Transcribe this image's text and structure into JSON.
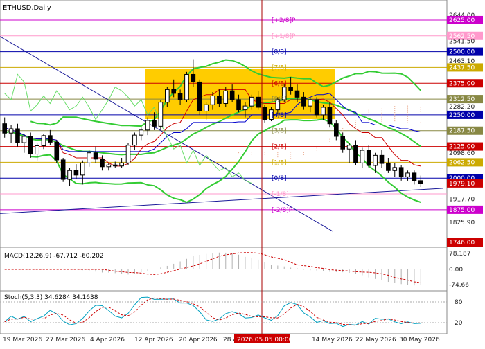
{
  "symbol_label": "ETHUSD,Daily",
  "macd_label": "MACD(12,26,9) -67.712 -60.202",
  "stoch_label": "Stoch(5,3,3) 34.6284 34.1638",
  "crosshair_label": "2026.05.05 00:00",
  "colors": {
    "background": "#ffffff",
    "bull": "#ffffff",
    "bear": "#000000",
    "bollinger": "#33cc33",
    "tenkan": "#cc0000",
    "kijun": "#0000cc",
    "chikou": "#66dd66",
    "highlight_box": "#ffcc00",
    "crosshair": "#aa0000",
    "trendline": "#1a1a99",
    "axis_text": "#222222",
    "price_highlight": "#cc0000",
    "macd_hist": "#b0b0b0",
    "macd_signal": "#cc0000",
    "stoch_main": "#00a0c0",
    "stoch_signal": "#cc0000"
  },
  "chart_data": {
    "type": "candlestick",
    "price_range": [
      1746,
      2644
    ],
    "price_ticks": [
      "2644.00",
      "2625.00",
      "2562.50",
      "2541.50",
      "2500.00",
      "2463.10",
      "2437.50",
      "2375.00",
      "2312.50",
      "2282.20",
      "2250.00",
      "2187.50",
      "2125.00",
      "2098.60",
      "2062.50",
      "2000.00",
      "1979.10",
      "1917.70",
      "1875.00",
      "1825.90",
      "1746.00"
    ],
    "highlighted_ticks": [
      "2625.00",
      "2562.50",
      "2500.00",
      "2437.50",
      "2375.00",
      "2312.50",
      "2250.00",
      "2187.50",
      "2125.00",
      "2062.50",
      "2000.00",
      "1979.10",
      "1875.00",
      "1746.00"
    ],
    "murrey_levels": [
      {
        "label": "[+2/8]P",
        "value": 2625.0,
        "color": "#cc00cc"
      },
      {
        "label": "[+1/8]P",
        "value": 2562.5,
        "color": "#ff99cc"
      },
      {
        "label": "[8/8]",
        "value": 2500.0,
        "color": "#0000aa"
      },
      {
        "label": "[7/8]",
        "value": 2437.5,
        "color": "#ccaa00"
      },
      {
        "label": "[6/8]",
        "value": 2375.0,
        "color": "#cc0000"
      },
      {
        "label": "[5/8]",
        "value": 2312.5,
        "color": "#888844"
      },
      {
        "label": "[4/8]",
        "value": 2250.0,
        "color": "#0000aa"
      },
      {
        "label": "[3/8]",
        "value": 2187.5,
        "color": "#888844"
      },
      {
        "label": "[2/8]",
        "value": 2125.0,
        "color": "#cc0000"
      },
      {
        "label": "[1/8]",
        "value": 2062.5,
        "color": "#ccaa00"
      },
      {
        "label": "[0/8]",
        "value": 2000.0,
        "color": "#0000aa"
      },
      {
        "label": "[-1/8]",
        "value": 1937.5,
        "color": "#ff99cc"
      },
      {
        "label": "[-2/8]P",
        "value": 1875.0,
        "color": "#cc00cc"
      }
    ],
    "dates": [
      "19 Mar 2026",
      "27 Mar 2026",
      "4 Apr 2026",
      "12 Apr 2026",
      "20 Apr 2026",
      "28 Apr 2026",
      "14 May 2026",
      "22 May 2026",
      "30 May 2026"
    ],
    "candles": [
      [
        2215,
        2240,
        2160,
        2178
      ],
      [
        2178,
        2210,
        2140,
        2195
      ],
      [
        2195,
        2215,
        2125,
        2140
      ],
      [
        2140,
        2175,
        2100,
        2165
      ],
      [
        2165,
        2180,
        2080,
        2095
      ],
      [
        2095,
        2140,
        2070,
        2128
      ],
      [
        2128,
        2175,
        2115,
        2168
      ],
      [
        2168,
        2190,
        2130,
        2142
      ],
      [
        2142,
        2150,
        2060,
        2072
      ],
      [
        2072,
        2080,
        1985,
        1995
      ],
      [
        1995,
        2040,
        1970,
        2030
      ],
      [
        2030,
        2055,
        1995,
        2012
      ],
      [
        2012,
        2070,
        1975,
        2060
      ],
      [
        2060,
        2110,
        2045,
        2100
      ],
      [
        2100,
        2125,
        2060,
        2075
      ],
      [
        2075,
        2090,
        2030,
        2045
      ],
      [
        2045,
        2060,
        2030,
        2052
      ],
      [
        2052,
        2065,
        2040,
        2048
      ],
      [
        2048,
        2080,
        2040,
        2060
      ],
      [
        2060,
        2140,
        2050,
        2130
      ],
      [
        2130,
        2180,
        2110,
        2170
      ],
      [
        2170,
        2200,
        2150,
        2190
      ],
      [
        2190,
        2240,
        2170,
        2228
      ],
      [
        2228,
        2260,
        2190,
        2205
      ],
      [
        2205,
        2310,
        2190,
        2300
      ],
      [
        2300,
        2360,
        2280,
        2350
      ],
      [
        2350,
        2390,
        2320,
        2335
      ],
      [
        2335,
        2350,
        2290,
        2310
      ],
      [
        2310,
        2420,
        2300,
        2410
      ],
      [
        2410,
        2470,
        2360,
        2380
      ],
      [
        2380,
        2390,
        2250,
        2265
      ],
      [
        2265,
        2300,
        2230,
        2290
      ],
      [
        2290,
        2340,
        2270,
        2325
      ],
      [
        2325,
        2350,
        2280,
        2295
      ],
      [
        2295,
        2360,
        2280,
        2345
      ],
      [
        2345,
        2370,
        2300,
        2310
      ],
      [
        2310,
        2330,
        2260,
        2270
      ],
      [
        2270,
        2300,
        2240,
        2285
      ],
      [
        2285,
        2330,
        2270,
        2320
      ],
      [
        2320,
        2345,
        2270,
        2280
      ],
      [
        2280,
        2290,
        2220,
        2232
      ],
      [
        2232,
        2280,
        2225,
        2270
      ],
      [
        2270,
        2320,
        2255,
        2310
      ],
      [
        2310,
        2370,
        2300,
        2360
      ],
      [
        2360,
        2400,
        2330,
        2345
      ],
      [
        2345,
        2370,
        2300,
        2320
      ],
      [
        2320,
        2340,
        2270,
        2285
      ],
      [
        2285,
        2320,
        2260,
        2310
      ],
      [
        2310,
        2320,
        2240,
        2250
      ],
      [
        2250,
        2290,
        2230,
        2280
      ],
      [
        2280,
        2300,
        2200,
        2215
      ],
      [
        2215,
        2230,
        2150,
        2165
      ],
      [
        2165,
        2180,
        2100,
        2115
      ],
      [
        2115,
        2140,
        2060,
        2130
      ],
      [
        2130,
        2150,
        2050,
        2060
      ],
      [
        2060,
        2120,
        2040,
        2110
      ],
      [
        2110,
        2130,
        2040,
        2050
      ],
      [
        2050,
        2100,
        2020,
        2090
      ],
      [
        2090,
        2110,
        2040,
        2058
      ],
      [
        2058,
        2080,
        2020,
        2030
      ],
      [
        2030,
        2060,
        2005,
        2042
      ],
      [
        2042,
        2050,
        1990,
        2005
      ],
      [
        2005,
        2030,
        1990,
        2020
      ],
      [
        2020,
        2030,
        1975,
        1990
      ],
      [
        1990,
        2010,
        1965,
        1980
      ]
    ],
    "macd": {
      "main": -67.712,
      "signal": -60.202,
      "ticks": [
        "78.187",
        "0.00",
        "-74.66"
      ]
    },
    "stoch": {
      "main": 34.6284,
      "signal": 34.1638,
      "ticks": [
        "80",
        "20"
      ]
    }
  }
}
